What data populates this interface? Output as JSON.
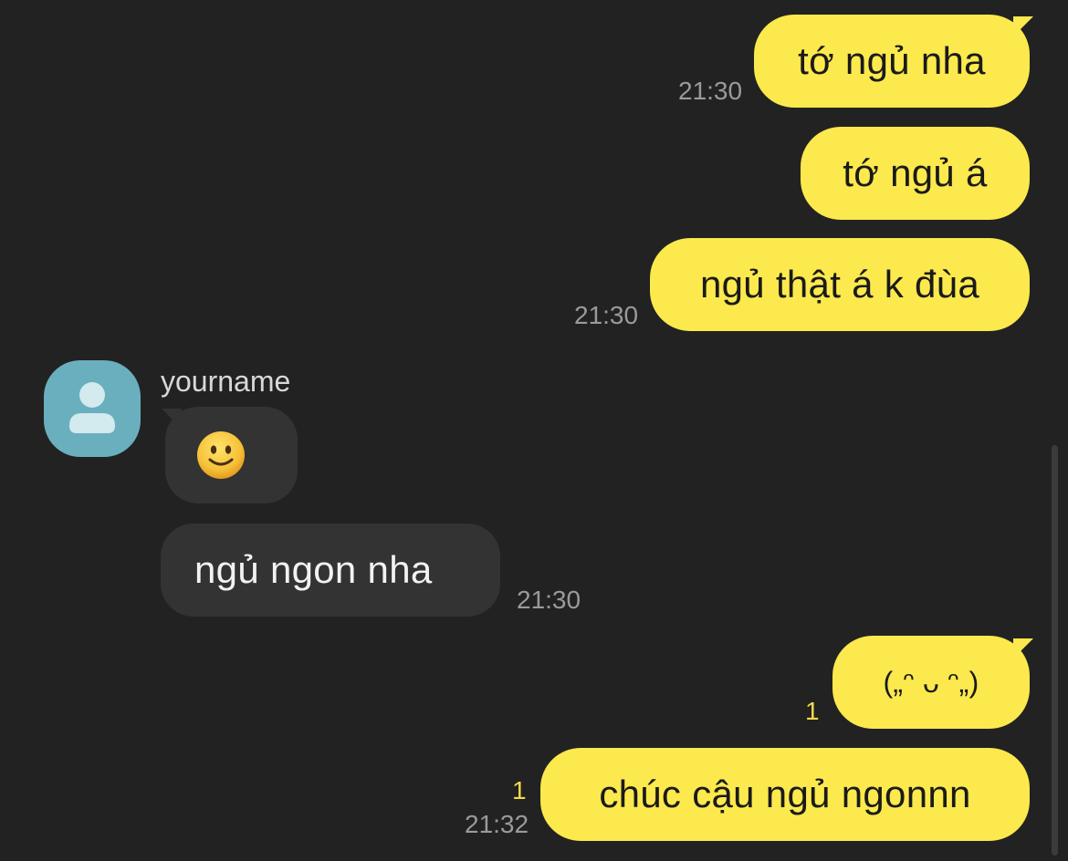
{
  "theme": {
    "background": "#222222",
    "outgoing_bubble": "#FCE94D",
    "incoming_bubble": "#333333",
    "unread_color": "#F4D94A",
    "avatar_color": "#6AAFBD"
  },
  "contact": {
    "name": "yourname",
    "avatar_icon": "person-icon"
  },
  "messages": [
    {
      "direction": "out",
      "text": "tớ ngủ nha",
      "time": "21:30"
    },
    {
      "direction": "out",
      "text": "tớ ngủ á",
      "time": ""
    },
    {
      "direction": "out",
      "text": "ngủ thật á k đùa",
      "time": "21:30"
    },
    {
      "direction": "in",
      "text": "",
      "emoji": "slightly-smiling-face-icon",
      "time": ""
    },
    {
      "direction": "in",
      "text": "ngủ ngon nha",
      "time": "21:30"
    },
    {
      "direction": "out",
      "text": "(„ᵔ ᴗ ᵔ„)",
      "time": "",
      "unread": "1"
    },
    {
      "direction": "out",
      "text": "chúc cậu ngủ ngonnn",
      "time": "21:32",
      "unread": "1"
    }
  ]
}
